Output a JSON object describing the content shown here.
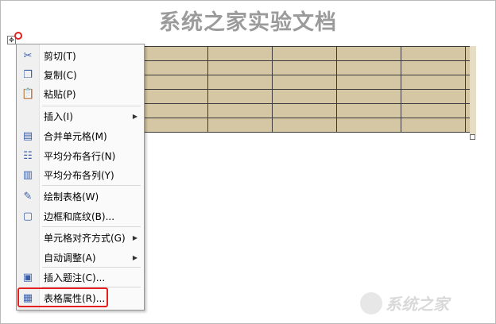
{
  "document": {
    "title": "系统之家实验文档",
    "move_handle_glyph": "✥"
  },
  "table": {
    "rows": 6,
    "cols": 6,
    "fill_color": "#d6c7a4"
  },
  "context_menu": {
    "items": [
      {
        "label": "剪切(T)",
        "icon": "scissors-icon",
        "glyph": "✂",
        "submenu": false
      },
      {
        "label": "复制(C)",
        "icon": "copy-icon",
        "glyph": "❐",
        "submenu": false
      },
      {
        "label": "粘贴(P)",
        "icon": "paste-icon",
        "glyph": "📋",
        "submenu": false
      },
      {
        "label": "插入(I)",
        "icon": "",
        "glyph": "",
        "submenu": true
      },
      {
        "label": "合并单元格(M)",
        "icon": "merge-cells-icon",
        "glyph": "▤",
        "submenu": false
      },
      {
        "label": "平均分布各行(N)",
        "icon": "distribute-rows-icon",
        "glyph": "☷",
        "submenu": false
      },
      {
        "label": "平均分布各列(Y)",
        "icon": "distribute-columns-icon",
        "glyph": "▥",
        "submenu": false
      },
      {
        "label": "绘制表格(W)",
        "icon": "draw-table-icon",
        "glyph": "✎",
        "submenu": false
      },
      {
        "label": "边框和底纹(B)...",
        "icon": "borders-shading-icon",
        "glyph": "▢",
        "submenu": false
      },
      {
        "label": "单元格对齐方式(G)",
        "icon": "",
        "glyph": "",
        "submenu": true
      },
      {
        "label": "自动调整(A)",
        "icon": "",
        "glyph": "",
        "submenu": true
      },
      {
        "label": "插入题注(C)...",
        "icon": "insert-caption-icon",
        "glyph": "▣",
        "submenu": false
      },
      {
        "label": "表格属性(R)...",
        "icon": "table-properties-icon",
        "glyph": "▦",
        "submenu": false
      }
    ],
    "submenu_arrow": "▶",
    "highlighted_item": "表格属性(R)..."
  },
  "watermark": {
    "text": "系统之家"
  },
  "colors": {
    "highlight_border": "#e41f1f",
    "title_text": "#9b9b9b"
  }
}
